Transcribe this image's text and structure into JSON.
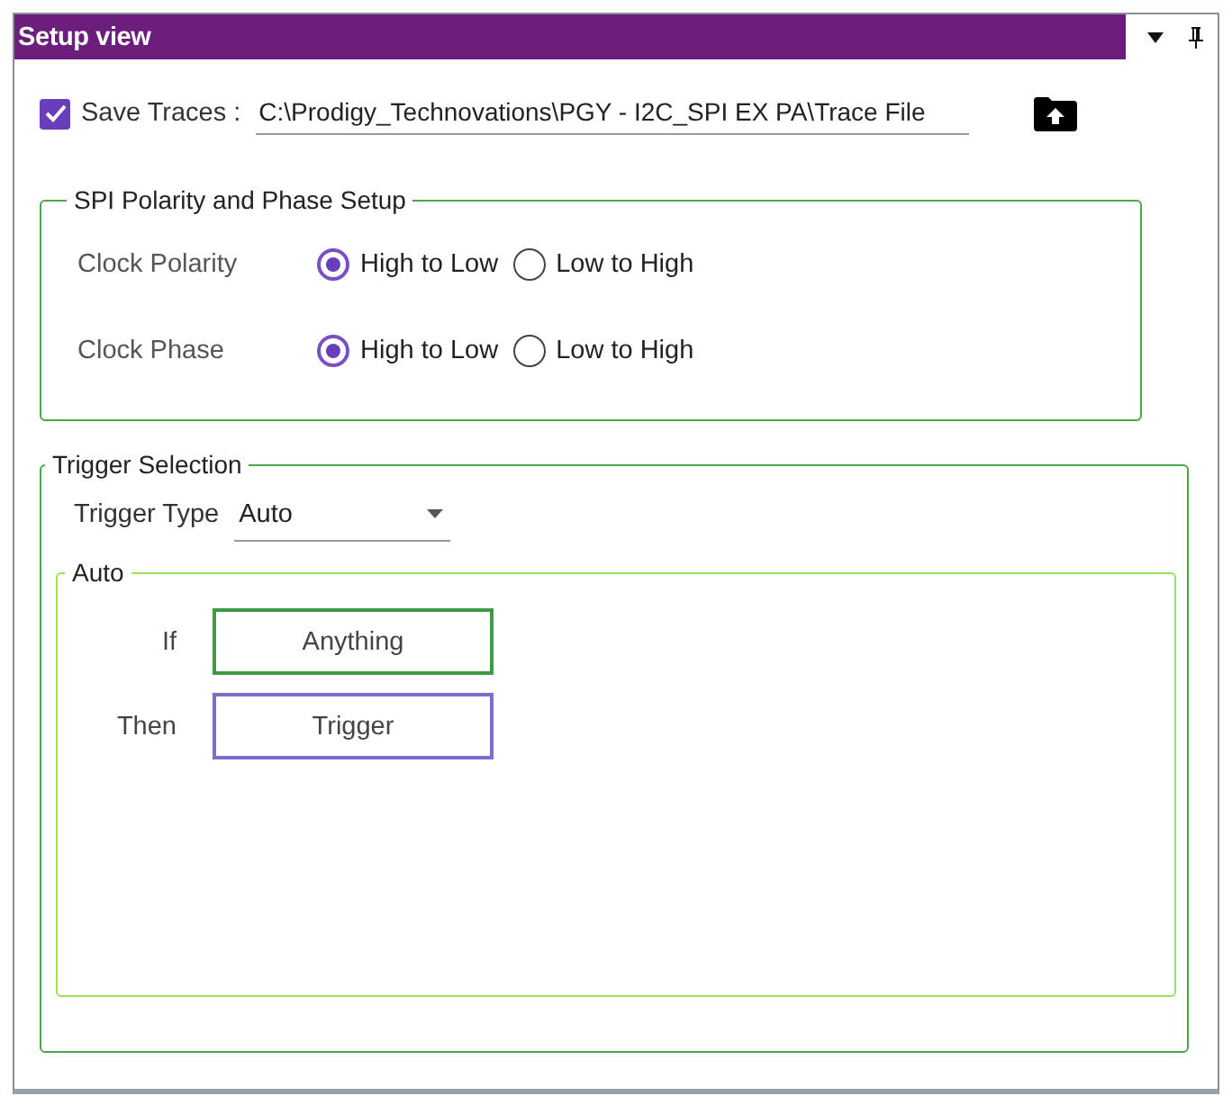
{
  "window": {
    "title": "Setup view"
  },
  "save_traces": {
    "label": "Save Traces :",
    "checked": true,
    "path": "C:\\Prodigy_Technovations\\PGY - I2C_SPI EX PA\\Trace File"
  },
  "spi_setup": {
    "title": "SPI Polarity and Phase Setup",
    "rows": [
      {
        "label": "Clock Polarity",
        "options": [
          {
            "label": "High to Low",
            "selected": true
          },
          {
            "label": "Low to High",
            "selected": false
          }
        ]
      },
      {
        "label": "Clock Phase",
        "options": [
          {
            "label": "High to Low",
            "selected": true
          },
          {
            "label": "Low to High",
            "selected": false
          }
        ]
      }
    ]
  },
  "trigger_selection": {
    "title": "Trigger Selection",
    "trigger_type": {
      "label": "Trigger Type",
      "value": "Auto"
    },
    "auto": {
      "title": "Auto",
      "rows": [
        {
          "label": "If",
          "button": "Anything",
          "kind": "condition"
        },
        {
          "label": "Then",
          "button": "Trigger",
          "kind": "action"
        }
      ]
    }
  }
}
